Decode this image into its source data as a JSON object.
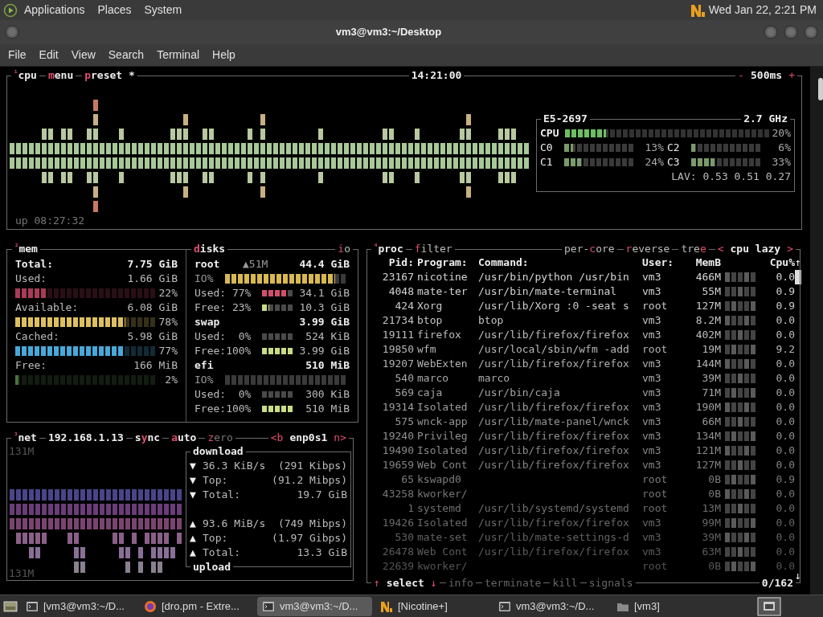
{
  "top_panel": {
    "menus": [
      "Applications",
      "Places",
      "System"
    ],
    "clock": "Wed Jan 22, 2:21 PM"
  },
  "window": {
    "title": "vm3@vm3:~/Desktop"
  },
  "menu_bar": [
    "File",
    "Edit",
    "View",
    "Search",
    "Terminal",
    "Help"
  ],
  "cpu": {
    "number": "¹",
    "title": "cpu",
    "buttons": [
      {
        "key": "m",
        "post": "enu"
      },
      {
        "key": "p",
        "post": "reset *"
      }
    ],
    "clock": "14:21:00",
    "interval": {
      "minus": "-",
      "value": "500ms",
      "plus": "+"
    },
    "uptime": "up 08:27:32",
    "model": "E5-2697",
    "frequency": "2.7 GHz",
    "total": {
      "label": "CPU",
      "level": 0.2,
      "reading": "20%"
    },
    "cores": [
      {
        "label": "C0",
        "level": 0.13,
        "reading": "13%"
      },
      {
        "label": "C2",
        "level": 0.06,
        "reading": "6%"
      },
      {
        "label": "C1",
        "level": 0.24,
        "reading": "24%"
      },
      {
        "label": "C3",
        "level": 0.33,
        "reading": "33%"
      }
    ],
    "load": "LAV: 0.53 0.51 0.27"
  },
  "mem": {
    "number": "²",
    "title": "mem",
    "total": {
      "label": "Total:",
      "value": "7.75 GiB"
    },
    "stats": [
      {
        "label": "Used:",
        "value": "1.66 GiB",
        "level": 0.22,
        "reading": "22%",
        "color": "#a83c58"
      },
      {
        "label": "Available:",
        "value": "6.08 GiB",
        "level": 0.78,
        "reading": "78%",
        "color": "#dcc060"
      },
      {
        "label": "Cached:",
        "value": "5.98 GiB",
        "level": 0.77,
        "reading": "77%",
        "color": "#48a8d8"
      },
      {
        "label": "Free:",
        "value": "166 MiB",
        "level": 0.02,
        "reading": "2%",
        "color": "#4c7040"
      }
    ]
  },
  "disks": {
    "title": {
      "key": "d",
      "post": "isks"
    },
    "io_button": {
      "key": "i",
      "post": "o"
    },
    "devices": [
      {
        "name": "root",
        "io_rate": "▲51M",
        "size": "44.4 GiB",
        "io": {
          "label": "IO%",
          "level": 0.9
        },
        "used": {
          "label": "Used: 77%",
          "level": 0.77,
          "value": "34.1 GiB"
        },
        "free": {
          "label": "Free: 23%",
          "level": 0.23,
          "value": "10.3 GiB"
        }
      },
      {
        "name": "swap",
        "size": "3.99 GiB",
        "used": {
          "label": "Used:  0%",
          "level": 0,
          "value": "524 KiB"
        },
        "free": {
          "label": "Free:100%",
          "level": 1,
          "value": "3.99 GiB"
        }
      },
      {
        "name": "efi",
        "size": "510 MiB",
        "io": {
          "label": "IO%",
          "level": 0
        },
        "used": {
          "label": "Used:  0%",
          "level": 0,
          "value": "300 KiB"
        },
        "free": {
          "label": "Free:100%",
          "level": 1,
          "value": "510 MiB"
        }
      }
    ]
  },
  "net": {
    "number": "³",
    "title": "net",
    "address": "192.168.1.13",
    "buttons": [
      {
        "pre": "s",
        "key": "y",
        "post": "nc",
        "on": true
      },
      {
        "key": "a",
        "post": "uto",
        "on": true
      },
      {
        "key": "z",
        "post": "ero",
        "on": false
      }
    ],
    "interface": {
      "prev": "<b",
      "name": "enp0s1",
      "next": "n>"
    },
    "scale_top": "131M",
    "scale_bottom": "131M",
    "download": {
      "title": "download",
      "rows": [
        {
          "arrow": "▼",
          "label": "36.3 KiB/s",
          "value": "(291 Kibps)"
        },
        {
          "arrow": "▼",
          "label": "Top:",
          "value": "(91.2 Mibps)"
        },
        {
          "arrow": "▼",
          "label": "Total:",
          "value": "19.7 GiB"
        }
      ]
    },
    "upload": {
      "title": "upload",
      "rows": [
        {
          "arrow": "▲",
          "label": "93.6 MiB/s",
          "value": "(749 Mibps)"
        },
        {
          "arrow": "▲",
          "label": "Top:",
          "value": "(1.97 Gibps)"
        },
        {
          "arrow": "▲",
          "label": "Total:",
          "value": "13.3 GiB"
        }
      ]
    }
  },
  "proc": {
    "number": "⁴",
    "title": "proc",
    "left_options": [
      {
        "key": "f",
        "post": "ilter"
      }
    ],
    "right_options": [
      {
        "pre": "per-",
        "key": "c",
        "post": "ore"
      },
      {
        "key": "r",
        "post": "everse"
      },
      {
        "pre": "tre",
        "key": "e"
      }
    ],
    "sort": {
      "prev": "<",
      "name": "cpu lazy",
      "next": ">"
    },
    "columns": [
      "Pid:",
      "Program:",
      "Command:",
      "User:",
      "MemB",
      "Cpu%"
    ],
    "rows": [
      {
        "pid": "23167",
        "program": "nicotine",
        "command": "/usr/bin/python /usr/bin",
        "user": "vm3",
        "mem": "466M",
        "cpu": "0.0"
      },
      {
        "pid": "4048",
        "program": "mate-ter",
        "command": "/usr/bin/mate-terminal",
        "user": "vm3",
        "mem": "55M",
        "cpu": "0.9"
      },
      {
        "pid": "424",
        "program": "Xorg",
        "command": "/usr/lib/Xorg :0 -seat s",
        "user": "root",
        "mem": "127M",
        "cpu": "0.9"
      },
      {
        "pid": "21734",
        "program": "btop",
        "command": "btop",
        "user": "vm3",
        "mem": "8.2M",
        "cpu": "0.0"
      },
      {
        "pid": "19111",
        "program": "firefox",
        "command": "/usr/lib/firefox/firefox",
        "user": "vm3",
        "mem": "402M",
        "cpu": "0.0"
      },
      {
        "pid": "19850",
        "program": "wfm",
        "command": "/usr/local/sbin/wfm -add",
        "user": "root",
        "mem": "19M",
        "cpu": "9.2"
      },
      {
        "pid": "19207",
        "program": "WebExten",
        "command": "/usr/lib/firefox/firefox",
        "user": "vm3",
        "mem": "144M",
        "cpu": "0.0"
      },
      {
        "pid": "540",
        "program": "marco",
        "command": "marco",
        "user": "vm3",
        "mem": "39M",
        "cpu": "0.0"
      },
      {
        "pid": "569",
        "program": "caja",
        "command": "/usr/bin/caja",
        "user": "vm3",
        "mem": "71M",
        "cpu": "0.0"
      },
      {
        "pid": "19314",
        "program": "Isolated",
        "command": "/usr/lib/firefox/firefox",
        "user": "vm3",
        "mem": "190M",
        "cpu": "0.0"
      },
      {
        "pid": "575",
        "program": "wnck-app",
        "command": "/usr/lib/mate-panel/wnck",
        "user": "vm3",
        "mem": "66M",
        "cpu": "0.0"
      },
      {
        "pid": "19240",
        "program": "Privileg",
        "command": "/usr/lib/firefox/firefox",
        "user": "vm3",
        "mem": "134M",
        "cpu": "0.0"
      },
      {
        "pid": "19490",
        "program": "Isolated",
        "command": "/usr/lib/firefox/firefox",
        "user": "vm3",
        "mem": "121M",
        "cpu": "0.0"
      },
      {
        "pid": "19659",
        "program": "Web Cont",
        "command": "/usr/lib/firefox/firefox",
        "user": "vm3",
        "mem": "127M",
        "cpu": "0.0"
      },
      {
        "pid": "65",
        "program": "kswapd0",
        "user": "root",
        "mem": "0B",
        "cpu": "0.9"
      },
      {
        "pid": "43258",
        "program": "kworker/",
        "user": "root",
        "mem": "0B",
        "cpu": "0.0"
      },
      {
        "pid": "1",
        "program": "systemd",
        "command": "/usr/lib/systemd/systemd",
        "user": "root",
        "mem": "13M",
        "cpu": "0.0"
      },
      {
        "pid": "19426",
        "program": "Isolated",
        "command": "/usr/lib/firefox/firefox",
        "user": "vm3",
        "mem": "99M",
        "cpu": "0.0"
      },
      {
        "pid": "530",
        "program": "mate-set",
        "command": "/usr/lib/mate-settings-d",
        "user": "vm3",
        "mem": "39M",
        "cpu": "0.0"
      },
      {
        "pid": "26478",
        "program": "Web Cont",
        "command": "/usr/lib/firefox/firefox",
        "user": "vm3",
        "mem": "63M",
        "cpu": "0.0"
      },
      {
        "pid": "22639",
        "program": "kworker/",
        "user": "root",
        "mem": "0B",
        "cpu": "0.0"
      }
    ],
    "scroll_up": "↑",
    "scroll_down": "↓",
    "footer": {
      "up": "↑",
      "select": "select",
      "down": "↓",
      "actions": [
        "info",
        "terminate",
        "kill",
        "signals"
      ],
      "count": "0/162"
    }
  },
  "taskbar": {
    "items": [
      {
        "kind": "terminal",
        "label": "[vm3@vm3:~/D...",
        "selected": false
      },
      {
        "kind": "browser",
        "label": "[dro.pm - Extre...",
        "selected": false
      },
      {
        "kind": "terminal",
        "label": "vm3@vm3:~/D...",
        "selected": true
      },
      {
        "kind": "app",
        "label": "[Nicotine+]",
        "selected": false
      },
      {
        "kind": "terminal",
        "label": "vm3@vm3:~/D...",
        "selected": false
      },
      {
        "kind": "folder",
        "label": "[vm3]",
        "selected": false
      }
    ]
  }
}
